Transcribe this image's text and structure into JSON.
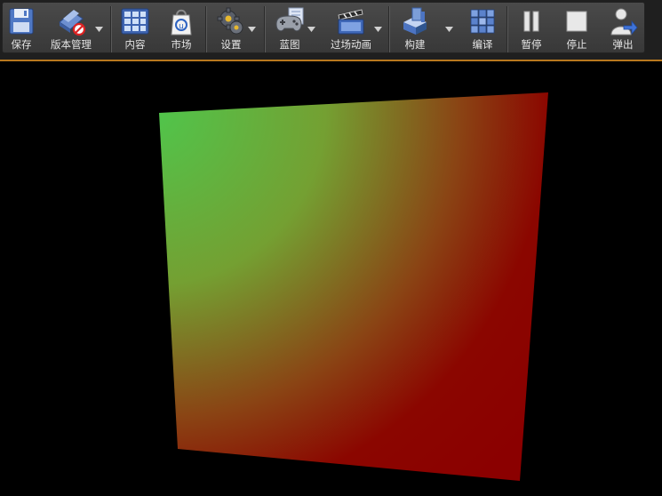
{
  "toolbar": {
    "save_label": "保存",
    "source_control_label": "版本管理",
    "content_label": "内容",
    "marketplace_label": "市场",
    "settings_label": "设置",
    "blueprints_label": "蓝图",
    "cinematics_label": "过场动画",
    "build_label": "构建",
    "compile_label": "编译",
    "pause_label": "暂停",
    "stop_label": "停止",
    "eject_label": "弹出"
  },
  "colors": {
    "accent": "#b8781e",
    "quad_green": "#4fc44a",
    "quad_red": "#8b0000"
  }
}
